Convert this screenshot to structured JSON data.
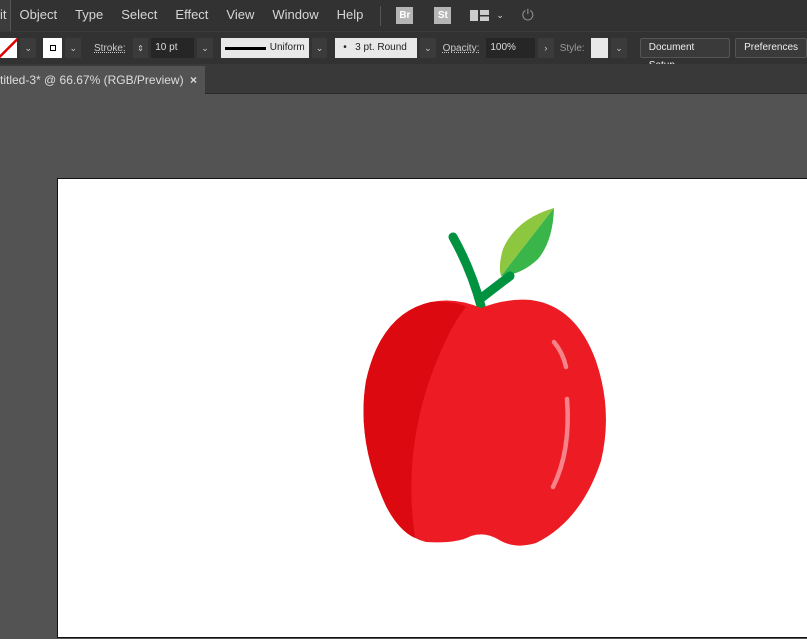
{
  "menu": {
    "items": [
      "it",
      "Object",
      "Type",
      "Select",
      "Effect",
      "View",
      "Window",
      "Help"
    ],
    "bridge": "Br",
    "stock": "St"
  },
  "control": {
    "stroke_label": "Stroke:",
    "stroke_value": "10 pt",
    "profile": "Uniform",
    "brush": "3 pt. Round",
    "opacity_label": "Opacity:",
    "opacity_value": "100%",
    "style_label": "Style:",
    "document_setup": "Document Setup",
    "preferences": "Preferences"
  },
  "tab": {
    "title": "titled-3* @ 66.67% (RGB/Preview)",
    "close": "×"
  },
  "artwork": {
    "colors": {
      "apple_main": "#ed1c24",
      "apple_shade": "#dc0a10",
      "highlight": "#f7838a",
      "stem": "#00923f",
      "leaf_light": "#8dc63f",
      "leaf_dark": "#39b54a"
    }
  }
}
